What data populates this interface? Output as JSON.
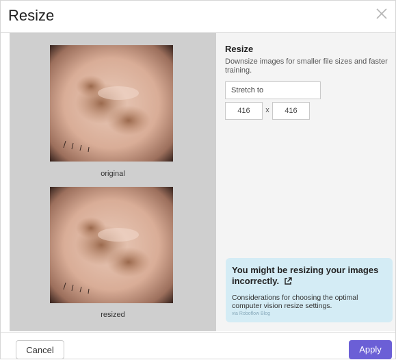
{
  "dialog": {
    "title": "Resize"
  },
  "preview": {
    "original_caption": "original",
    "resized_caption": "resized"
  },
  "settings": {
    "heading": "Resize",
    "description": "Downsize images for smaller file sizes and faster training.",
    "mode_value": "Stretch to",
    "width_value": "416",
    "times_symbol": "x",
    "height_value": "416"
  },
  "tip": {
    "title": "You might be resizing your images incorrectly.",
    "description": "Considerations for choosing the optimal computer vision resize settings.",
    "source": "via Roboflow Blog"
  },
  "footer": {
    "cancel_label": "Cancel",
    "apply_label": "Apply"
  },
  "colors": {
    "accent": "#6b5fd6",
    "tip_bg": "#d4ecf5",
    "preview_bg": "#cfcfcf"
  }
}
